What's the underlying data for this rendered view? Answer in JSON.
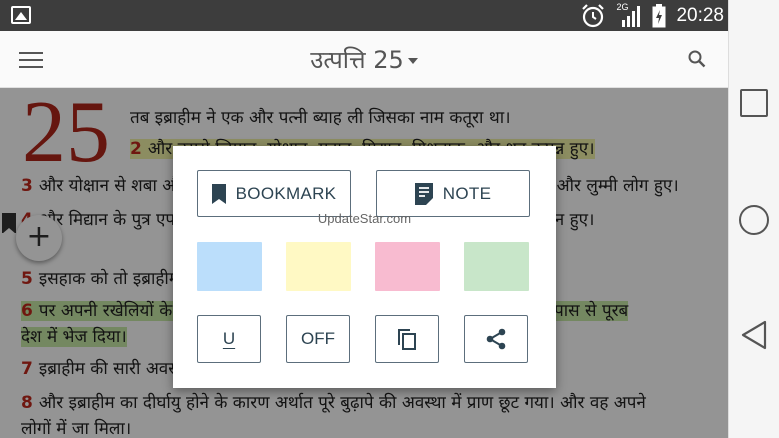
{
  "status_bar": {
    "time": "20:28",
    "network_label": "2G"
  },
  "app_bar": {
    "title": "उत्पत्ति 25"
  },
  "content": {
    "chapter_number": "25",
    "verses": [
      {
        "num": "",
        "text": "तब इब्राहीम ने एक और पत्नी ब्याह ली जिसका नाम कतूरा था।"
      },
      {
        "num": "2",
        "text": "और उससे जिम्रान, योक्षान, मदान, मिद्यान, यिशबाक, और शूह उत्पन्न हुए।"
      },
      {
        "num": "3",
        "text": "और योक्षान से शबा और ददान उत्पन्न हुए। और ददान के वंश में अश्शूरी, और लतूशी, और लुम्मी लोग हुए।"
      },
      {
        "num": "4",
        "text": "और मिद्यान के पुत्र एपा, एपेर, हनोक, अबीदा, और एल्दा हुए, ये सब कतूरा की सन्तान हुए।"
      },
      {
        "num": "5",
        "text": "इसहाक को तो इब्राहीम ने अपना सब कुछ दिया।"
      },
      {
        "num": "6",
        "text": "पर अपनी रखेलियों के पुत्रों को, कुछ कुछ देकर अपने जीते जी अपने पुत्र इसहाक के पास से पूरब"
      },
      {
        "num": "",
        "text": "देश में भेज दिया।"
      },
      {
        "num": "7",
        "text": "इब्राहीम की सारी अवस्था एक सौ पचहत्तर वर्ष की हुई।"
      },
      {
        "num": "8",
        "text": "और इब्राहीम का दीर्घायु होने के कारण अर्थात पूरे बुढ़ापे की अवस्था में प्राण छूट गया। और वह अपने"
      },
      {
        "num": "",
        "text": "लोगों में जा मिला।"
      }
    ]
  },
  "dialog": {
    "bookmark_label": "BOOKMARK",
    "note_label": "NOTE",
    "watermark": "UpdateStar.com",
    "underline_label": "U",
    "off_label": "OFF",
    "swatches": [
      {
        "name": "blue",
        "color": "#bbdefb"
      },
      {
        "name": "yellow",
        "color": "#fff9c4"
      },
      {
        "name": "pink",
        "color": "#f8bbd0"
      },
      {
        "name": "green",
        "color": "#c8e6c9"
      }
    ]
  },
  "colors": {
    "verse_number": "#c0281c",
    "highlight_yellow": "#f1f3a8",
    "highlight_green": "#c9eba7",
    "button_border": "#5c6e7c"
  }
}
